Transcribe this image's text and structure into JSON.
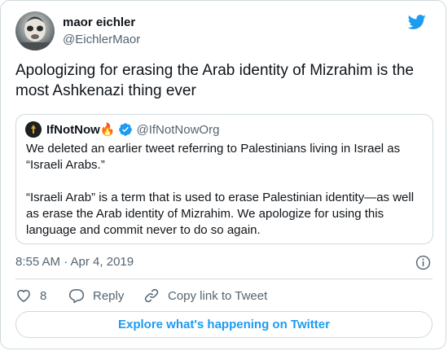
{
  "author": {
    "display_name": "maor eichler",
    "handle": "@EichlerMaor"
  },
  "tweet": {
    "text": "Apologizing for erasing the Arab identity of Mizrahim is the most Ashkenazi thing ever"
  },
  "quoted": {
    "display_name": "IfNotNow🔥",
    "handle": "@IfNotNowOrg",
    "paragraph1": "We deleted an earlier tweet referring to Palestinians living in Israel as “Israeli Arabs.”",
    "paragraph2": "“Israeli Arab” is a term that is used to erase Palestinian identity—as well as erase the Arab identity of Mizrahim. We apologize for using this language and commit never to do so again."
  },
  "meta": {
    "timestamp": "8:55 AM · Apr 4, 2019"
  },
  "actions": {
    "like_count": "8",
    "reply_label": "Reply",
    "copy_label": "Copy link to Tweet"
  },
  "footer": {
    "explore_label": "Explore what's happening on Twitter"
  },
  "colors": {
    "accent": "#1d9bf0",
    "secondary_text": "#536471",
    "border": "#cfd9de"
  },
  "icons": [
    "twitter-bird-icon",
    "verified-badge-icon",
    "info-icon",
    "heart-icon",
    "reply-icon",
    "link-icon"
  ]
}
